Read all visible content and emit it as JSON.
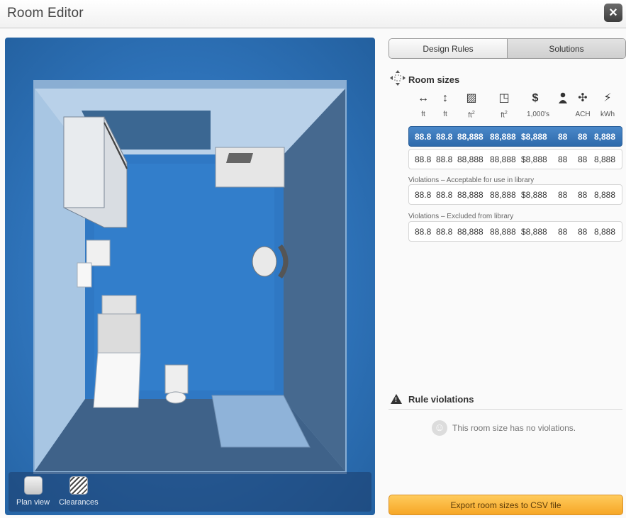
{
  "window": {
    "title": "Room Editor"
  },
  "tabs": [
    {
      "label": "Design Rules"
    },
    {
      "label": "Solutions"
    }
  ],
  "room_sizes": {
    "title": "Room sizes",
    "columns": [
      {
        "icon": "width-arrows-icon",
        "glyph": "↔",
        "unit": "ft"
      },
      {
        "icon": "height-arrows-icon",
        "glyph": "↕",
        "unit": "ft"
      },
      {
        "icon": "area-hatch-icon",
        "glyph": "▨",
        "unit": "ft",
        "unit_sup": "2"
      },
      {
        "icon": "area-outline-icon",
        "glyph": "◳",
        "unit": "ft",
        "unit_sup": "2"
      },
      {
        "icon": "dollar-icon",
        "glyph": "$",
        "unit": "1,000's"
      },
      {
        "icon": "person-icon",
        "glyph": "⯊",
        "unit": ""
      },
      {
        "icon": "fan-icon",
        "glyph": "✣",
        "unit": "ACH"
      },
      {
        "icon": "plug-icon",
        "glyph": "⚡",
        "unit": "kWh"
      }
    ],
    "rows": [
      {
        "values": [
          "88.8",
          "88.8",
          "88,888",
          "88,888",
          "$8,888",
          "88",
          "88",
          "8,888"
        ],
        "selected": true
      },
      {
        "values": [
          "88.8",
          "88.8",
          "88,888",
          "88,888",
          "$8,888",
          "88",
          "88",
          "8,888"
        ],
        "selected": false
      }
    ],
    "violations_acceptable": {
      "label": "Violations – Acceptable for use in library",
      "values": [
        "88.8",
        "88.8",
        "88,888",
        "88,888",
        "$8,888",
        "88",
        "88",
        "8,888"
      ]
    },
    "violations_excluded": {
      "label": "Violations – Excluded from library",
      "values": [
        "88.8",
        "88.8",
        "88,888",
        "88,888",
        "$8,888",
        "88",
        "88",
        "8,888"
      ]
    }
  },
  "rule_violations": {
    "title": "Rule violations",
    "message": "This room size has no violations."
  },
  "view_tools": [
    {
      "label": "Plan view"
    },
    {
      "label": "Clearances"
    }
  ],
  "export": {
    "label": "Export room sizes to CSV file"
  },
  "colors": {
    "accent_selected_row": "#3a78bd",
    "export_button": "#f6a626",
    "viewport_blue": "#2f74bb"
  }
}
